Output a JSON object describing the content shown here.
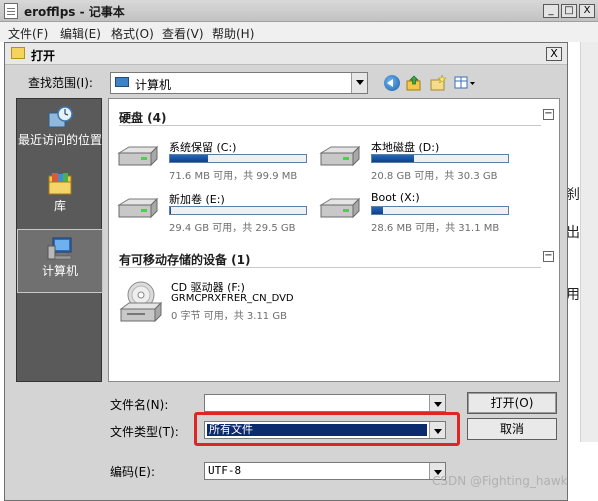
{
  "notepad": {
    "title": "erofflps - 记事本",
    "minimize_glyph": "_",
    "maximize_glyph": "□",
    "close_glyph": "X",
    "menus": [
      "文件(F)",
      "编辑(E)",
      "格式(O)",
      "查看(V)",
      "帮助(H)"
    ],
    "background_chars": [
      "刹",
      "出",
      "用"
    ]
  },
  "dialog": {
    "title": "打开",
    "close_glyph": "X",
    "look_in_label": "查找范围(I):",
    "look_in_value": "计算机",
    "places": [
      {
        "label": "最近访问的位置",
        "icon": "recent-places-icon"
      },
      {
        "label": "库",
        "icon": "libraries-icon"
      },
      {
        "label": "计算机",
        "icon": "computer-icon",
        "selected": true
      }
    ],
    "groups": {
      "hard_disks": {
        "title": "硬盘 (4)",
        "drives": [
          {
            "name": "系统保留 (C:)",
            "size": "71.6 MB 可用，共 99.9 MB",
            "used_fraction": 0.28
          },
          {
            "name": "本地磁盘 (D:)",
            "size": "20.8 GB 可用，共 30.3 GB",
            "used_fraction": 0.31
          },
          {
            "name": "新加卷 (E:)",
            "size": "29.4 GB 可用，共 29.5 GB",
            "used_fraction": 0.01
          },
          {
            "name": "Boot (X:)",
            "size": "28.6 MB 可用，共 31.1 MB",
            "used_fraction": 0.08
          }
        ]
      },
      "removable": {
        "title": "有可移动存储的设备 (1)",
        "device": {
          "name": "CD 驱动器 (F:)",
          "label": "GRMCPRXFRER_CN_DVD",
          "size": "0 字节 可用，共 3.11 GB"
        }
      },
      "collapse_glyph": "−"
    },
    "file_name_label": "文件名(N):",
    "file_name_value": "",
    "file_type_label": "文件类型(T):",
    "file_type_value": "所有文件",
    "encoding_label": "编码(E):",
    "encoding_value": "UTF-8",
    "open_button": "打开(O)",
    "cancel_button": "取消"
  },
  "watermark": "CSDN @Fighting_hawk",
  "colors": {
    "highlight": "#e02525",
    "selection": "#0c2a6e",
    "drive_bar": "#1f5aa8"
  }
}
